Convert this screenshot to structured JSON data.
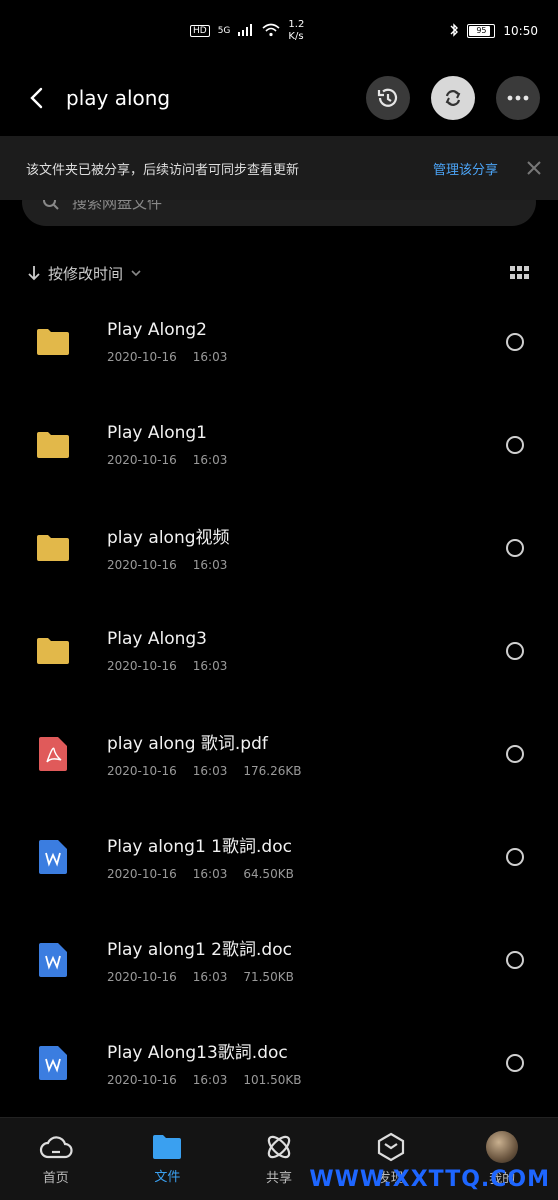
{
  "status_bar": {
    "hd": "HD",
    "network": "5G",
    "speed_value": "1.2",
    "speed_unit": "K/s",
    "battery": "95",
    "battery_level": 0.95,
    "time": "10:50"
  },
  "header": {
    "title": "play along"
  },
  "search": {
    "placeholder": "搜索网盘文件"
  },
  "share_banner": {
    "text": "该文件夹已被分享，后续访问者可同步查看更新",
    "link": "管理该分享"
  },
  "sort": {
    "label": "按修改时间"
  },
  "files": [
    {
      "name": "Play Along2",
      "date": "2020-10-16",
      "time": "16:03",
      "size": "",
      "type": "folder"
    },
    {
      "name": "Play Along1",
      "date": "2020-10-16",
      "time": "16:03",
      "size": "",
      "type": "folder"
    },
    {
      "name": "play along视频",
      "date": "2020-10-16",
      "time": "16:03",
      "size": "",
      "type": "folder"
    },
    {
      "name": "Play Along3",
      "date": "2020-10-16",
      "time": "16:03",
      "size": "",
      "type": "folder"
    },
    {
      "name": "play along 歌词.pdf",
      "date": "2020-10-16",
      "time": "16:03",
      "size": "176.26KB",
      "type": "pdf"
    },
    {
      "name": "Play along1 1歌詞.doc",
      "date": "2020-10-16",
      "time": "16:03",
      "size": "64.50KB",
      "type": "doc"
    },
    {
      "name": "Play along1 2歌詞.doc",
      "date": "2020-10-16",
      "time": "16:03",
      "size": "71.50KB",
      "type": "doc"
    },
    {
      "name": "Play Along13歌詞.doc",
      "date": "2020-10-16",
      "time": "16:03",
      "size": "101.50KB",
      "type": "doc"
    }
  ],
  "bottom_nav": [
    {
      "label": "首页",
      "icon": "cloud-home-icon"
    },
    {
      "label": "文件",
      "icon": "folder-icon"
    },
    {
      "label": "共享",
      "icon": "share-atom-icon"
    },
    {
      "label": "发现",
      "icon": "discover-box-icon"
    },
    {
      "label": "我的",
      "icon": "avatar"
    }
  ],
  "watermark": "WWW.XXTTQ.COM",
  "colors": {
    "accent": "#3aa0f0",
    "folder": "#e2b84a",
    "pdf": "#e05a5a",
    "doc": "#3b7de0",
    "background": "#000000"
  }
}
